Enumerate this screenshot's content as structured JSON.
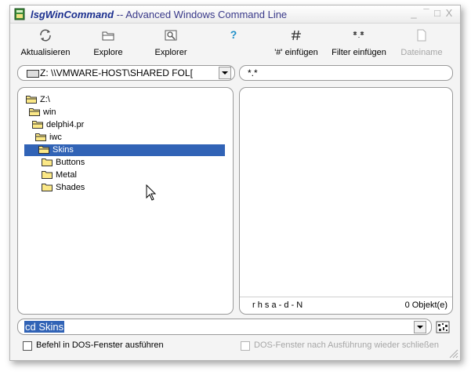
{
  "window": {
    "title_app": "lsgWinCommand",
    "title_rest": " -- Advanced Windows Command Line",
    "minimize": "_",
    "maximize": "¯",
    "restore": "□",
    "close": "X"
  },
  "toolbar": {
    "refresh": "Aktualisieren",
    "explore": "Explore",
    "explorer": "Explorer",
    "help_icon": "?",
    "insert_hash": "'#' einfügen",
    "insert_filter": "Filter einfügen",
    "filename": "Dateiname"
  },
  "path_combo": {
    "value": "Z: \\\\VMWARE-HOST\\SHARED FOL[",
    "filter": "*.*"
  },
  "tree": [
    {
      "label": "Z:\\"
    },
    {
      "label": "win"
    },
    {
      "label": "delphi4.pr"
    },
    {
      "label": "iwc"
    },
    {
      "label": "Skins"
    },
    {
      "label": "Buttons"
    },
    {
      "label": "Metal"
    },
    {
      "label": "Shades"
    }
  ],
  "filelist": {
    "attributes": "r h s a - d - N",
    "count": "0 Objekt(e)"
  },
  "command": {
    "value": "cd Skins"
  },
  "options": {
    "run_in_dos": "Befehl in DOS-Fenster ausführen",
    "close_dos": "DOS-Fenster nach Ausführung wieder schließen"
  },
  "colors": {
    "selection": "#3163b6",
    "title_app": "#1b2f8f",
    "help_icon": "#1f8fc8",
    "folder": "#fbe886"
  }
}
